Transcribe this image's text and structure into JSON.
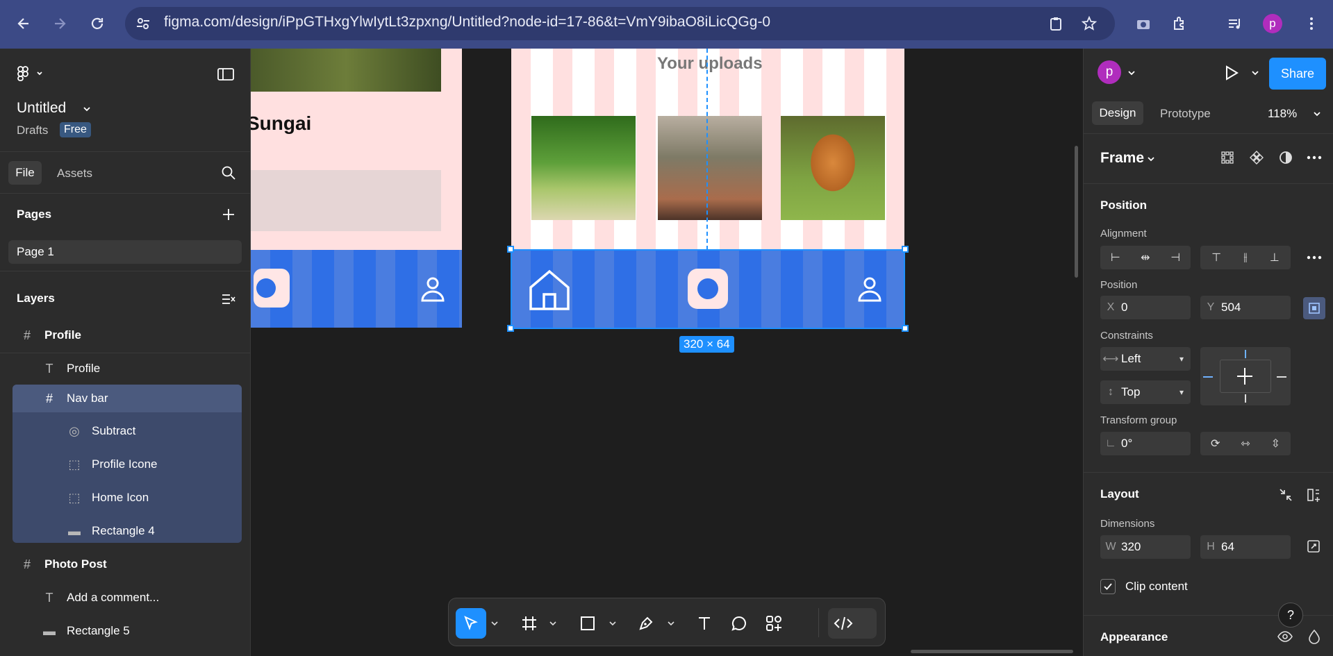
{
  "browser": {
    "url": "figma.com/design/iPpGTHxgYlwIytLt3zpxng/Untitled?node-id=17-86&t=VmY9ibaO8iLicQGg-0",
    "profile_initial": "p"
  },
  "left_panel": {
    "file_title": "Untitled",
    "drafts_label": "Drafts",
    "plan_badge": "Free",
    "tabs": {
      "file": "File",
      "assets": "Assets"
    },
    "pages_title": "Pages",
    "pages": [
      {
        "label": "Page 1"
      }
    ],
    "layers_title": "Layers",
    "layers": [
      {
        "label": "Profile",
        "type": "frame"
      },
      {
        "label": "Profile",
        "type": "text"
      },
      {
        "label": "Nav bar",
        "type": "frame"
      },
      {
        "label": "Subtract",
        "type": "component"
      },
      {
        "label": "Profile Icone",
        "type": "group"
      },
      {
        "label": "Home Icon",
        "type": "group"
      },
      {
        "label": "Rectangle 4",
        "type": "rectangle"
      },
      {
        "label": "Photo Post",
        "type": "frame"
      },
      {
        "label": "Add a comment...",
        "type": "text"
      },
      {
        "label": "Rectangle 5",
        "type": "rectangle"
      }
    ]
  },
  "canvas": {
    "left_frame_title": "Sungai",
    "right_frame_heading": "Your uploads",
    "selection_size": "320 × 64"
  },
  "right_panel": {
    "user_initial": "p",
    "share_label": "Share",
    "tabs": {
      "design": "Design",
      "prototype": "Prototype"
    },
    "zoom": "118%",
    "frame_label": "Frame",
    "position_section": "Position",
    "alignment_label": "Alignment",
    "position_label": "Position",
    "x_prefix": "X",
    "x_value": "0",
    "y_prefix": "Y",
    "y_value": "504",
    "constraints_label": "Constraints",
    "constraint_h": "Left",
    "constraint_v": "Top",
    "transform_label": "Transform group",
    "rotation": "0°",
    "layout_section": "Layout",
    "dimensions_label": "Dimensions",
    "w_prefix": "W",
    "w_value": "320",
    "h_prefix": "H",
    "h_value": "64",
    "clip_content": "Clip content",
    "appearance_section": "Appearance",
    "help": "?"
  },
  "colors": {
    "accent": "#1e90ff",
    "nav_bar": "#2f6fe6",
    "browser": "#3c4a86"
  }
}
